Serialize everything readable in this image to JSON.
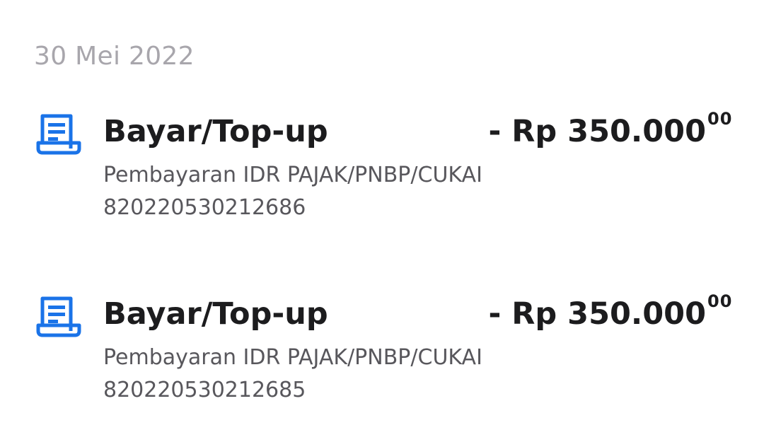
{
  "date_group": "30 Mei 2022",
  "accent_color": "#1a73e8",
  "transactions": [
    {
      "icon": "receipt-icon",
      "title": "Bayar/Top-up",
      "amount": "- Rp 350.000",
      "amount_cents": "00",
      "description": "Pembayaran IDR PAJAK/PNBP/CUKAI",
      "reference": "820220530212686"
    },
    {
      "icon": "receipt-icon",
      "title": "Bayar/Top-up",
      "amount": "- Rp 350.000",
      "amount_cents": "00",
      "description": "Pembayaran IDR PAJAK/PNBP/CUKAI",
      "reference": "820220530212685"
    }
  ]
}
